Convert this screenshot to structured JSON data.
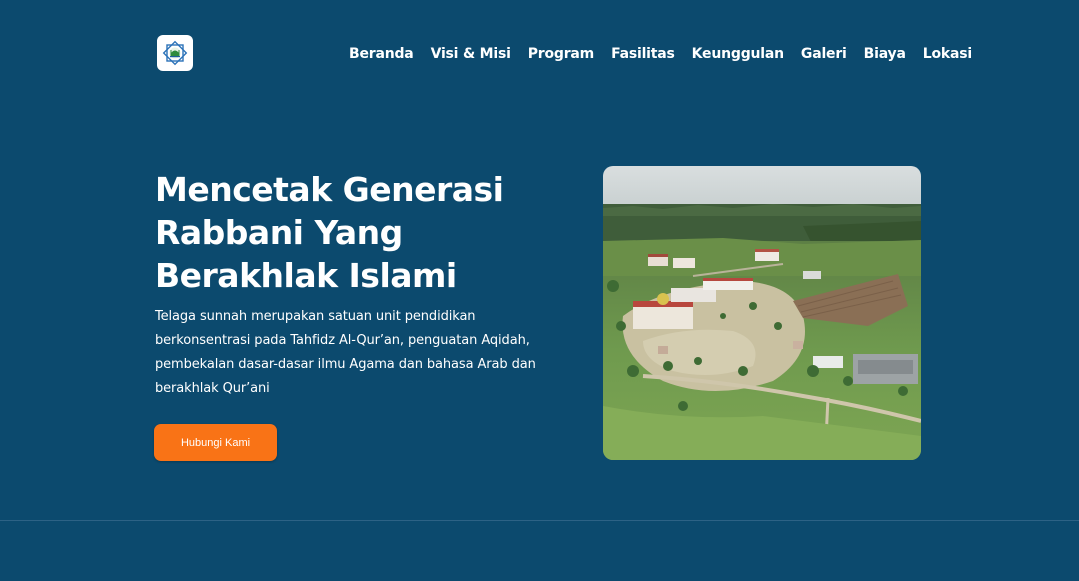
{
  "header": {
    "logo_alt": "Telaga Sunnah logo",
    "nav": [
      {
        "label": "Beranda"
      },
      {
        "label": "Visi & Misi"
      },
      {
        "label": "Program"
      },
      {
        "label": "Fasilitas"
      },
      {
        "label": "Keunggulan"
      },
      {
        "label": "Galeri"
      },
      {
        "label": "Biaya"
      },
      {
        "label": "Lokasi"
      }
    ]
  },
  "hero": {
    "title_lines": [
      "Mencetak Generasi",
      "Rabbani Yang",
      "Berakhlak Islami"
    ],
    "description_lines": [
      "Telaga sunnah merupakan satuan unit pendidikan",
      "berkonsentrasi pada Tahfidz Al-Qur’an, penguatan Aqidah,",
      "pembekalan dasar-dasar ilmu Agama dan bahasa Arab dan",
      "berakhlak Qur’ani"
    ],
    "cta_label": "Hubungi Kami",
    "image_alt": "Aerial view of the school campus"
  },
  "colors": {
    "background": "#0c4a6e",
    "accent": "#f97316",
    "text": "#ffffff"
  },
  "icons": {
    "logo": "mosque-star-logo-icon"
  }
}
